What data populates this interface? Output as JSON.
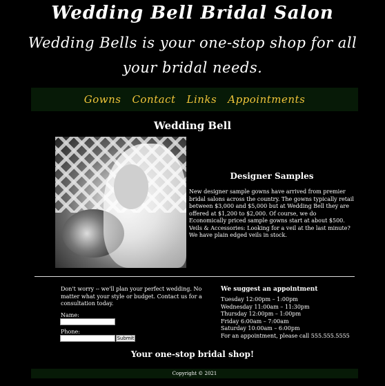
{
  "header": {
    "title": "Wedding Bell Bridal Salon",
    "tagline": "Wedding Bells is your one-stop shop for all your bridal needs."
  },
  "nav": {
    "items": [
      {
        "label": "Gowns"
      },
      {
        "label": "Contact"
      },
      {
        "label": "Links"
      },
      {
        "label": "Appointments"
      }
    ],
    "link_color": "#f0c53a",
    "bar_color": "#071a07"
  },
  "main": {
    "title": "Wedding Bell",
    "samples": {
      "heading": "Designer Samples",
      "body": "New designer sample gowns have arrived from premier bridal salons across the country. The gowns typically retail between $3,000 and $5,000 but at Wedding Bell they are offered at $1,200 to $2,000. Of course, we do Economically priced sample gowns start at about $500.",
      "veils": "Veils & Accessories: Looking for a veil at the last minute? We have plain edged veils in stock."
    }
  },
  "contact": {
    "text": "Don't worry -- we'll plan your perfect wedding. No matter what your style or budget. Contact us for a consultation today.",
    "name_label": "Name:",
    "name_value": "",
    "phone_label": "Phone:",
    "phone_value": "",
    "submit_label": "Submit"
  },
  "appointment": {
    "heading": "We suggest an appointment",
    "hours": [
      "Tuesday 12:00pm – 1:00pm",
      "Wednesday 11:00am – 11:30pm",
      "Thursday 12:00pm – 1:00pm",
      "Friday 6:00am – 7:00am",
      "Saturday 10:00am – 6:00pm",
      "For an appointment, please call 555.555.5555"
    ]
  },
  "bottom": {
    "slogan": "Your one-stop bridal shop!"
  },
  "footer": {
    "copyright": "Copyright © 2021"
  }
}
